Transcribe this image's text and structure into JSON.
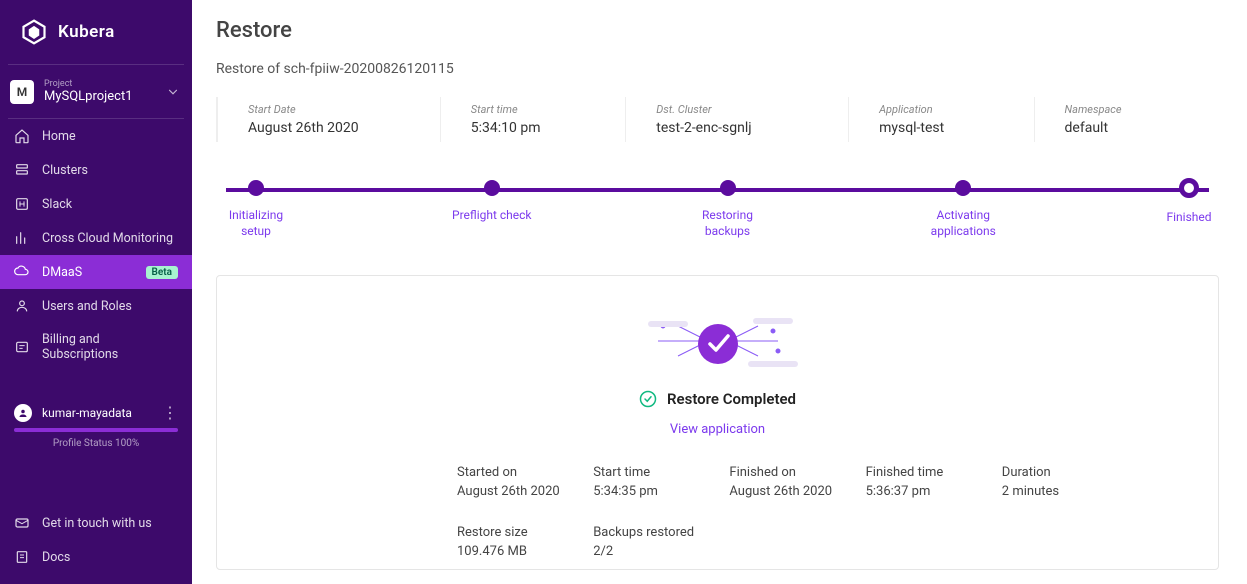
{
  "brand": "Kubera",
  "project": {
    "label": "Project",
    "initial": "M",
    "name": "MySQLproject1"
  },
  "sidebar": {
    "items": [
      {
        "label": "Home",
        "icon": "home-icon"
      },
      {
        "label": "Clusters",
        "icon": "clusters-icon"
      },
      {
        "label": "Slack",
        "icon": "slack-icon"
      },
      {
        "label": "Cross Cloud Monitoring",
        "icon": "monitoring-icon"
      },
      {
        "label": "DMaaS",
        "icon": "dmaas-icon",
        "badge": "Beta",
        "active": true
      },
      {
        "label": "Users and Roles",
        "icon": "users-icon"
      },
      {
        "label": "Billing and Subscriptions",
        "icon": "billing-icon"
      }
    ]
  },
  "user": {
    "name": "kumar-mayadata",
    "profile_status": "Profile Status 100%"
  },
  "bottom_links": [
    {
      "label": "Get in touch with us",
      "icon": "contact-icon"
    },
    {
      "label": "Docs",
      "icon": "docs-icon"
    }
  ],
  "page": {
    "title": "Restore",
    "subtitle": "Restore of sch-fpiiw-20200826120115"
  },
  "meta": [
    {
      "label": "Start Date",
      "value": "August 26th 2020"
    },
    {
      "label": "Start time",
      "value": "5:34:10 pm"
    },
    {
      "label": "Dst. Cluster",
      "value": "test-2-enc-sgnlj"
    },
    {
      "label": "Application",
      "value": "mysql-test"
    },
    {
      "label": "Namespace",
      "value": "default"
    }
  ],
  "steps": [
    "Initializing setup",
    "Preflight check",
    "Restoring backups",
    "Activating applications",
    "Finished"
  ],
  "result": {
    "status": "Restore Completed",
    "view_link": "View application"
  },
  "details": [
    {
      "label": "Started on",
      "value": "August 26th 2020"
    },
    {
      "label": "Start time",
      "value": "5:34:35 pm"
    },
    {
      "label": "Finished on",
      "value": "August 26th 2020"
    },
    {
      "label": "Finished time",
      "value": "5:36:37 pm"
    },
    {
      "label": "Duration",
      "value": "2 minutes"
    },
    {
      "label": "Restore size",
      "value": "109.476 MB"
    },
    {
      "label": "Backups restored",
      "value": "2/2"
    }
  ]
}
